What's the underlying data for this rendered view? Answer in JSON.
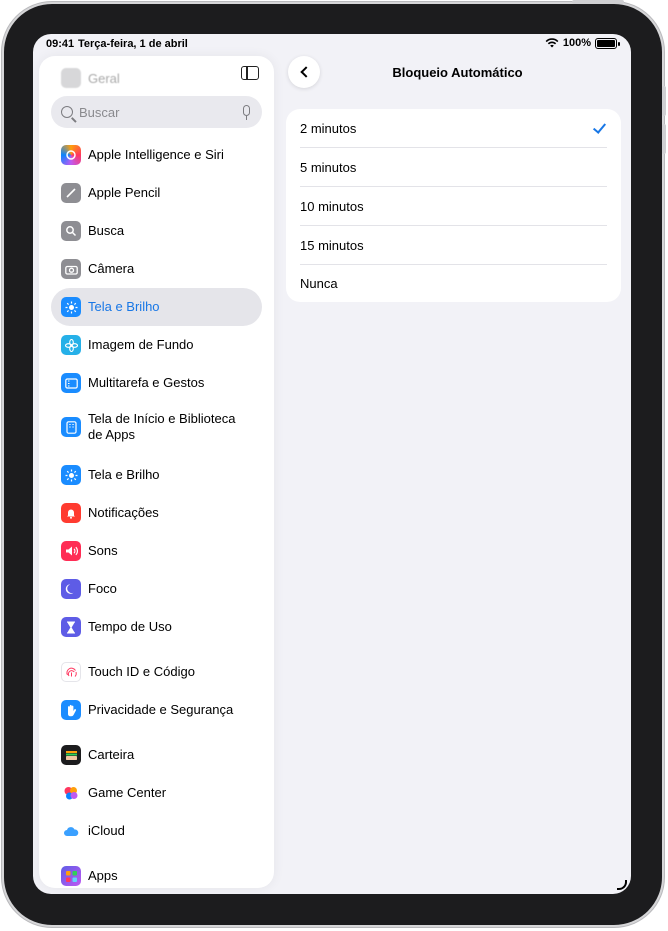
{
  "statusbar": {
    "time": "09:41",
    "date": "Terça-feira, 1 de abril",
    "battery": "100%"
  },
  "sidebar": {
    "hidden_top_item": "Geral",
    "search_placeholder": "Buscar",
    "items": [
      {
        "label": "Apple Intelligence e Siri",
        "icon": "apple-intelligence-icon",
        "color": "#ff7a59"
      },
      {
        "label": "Apple Pencil",
        "icon": "pencil-icon",
        "color": "#8e8e93"
      },
      {
        "label": "Busca",
        "icon": "search-icon",
        "color": "#8e8e93"
      },
      {
        "label": "Câmera",
        "icon": "camera-icon",
        "color": "#8e8e93"
      },
      {
        "label": "Tela e Brilho",
        "icon": "sun-icon",
        "color": "#1a8cff",
        "selected": true
      },
      {
        "label": "Imagem de Fundo",
        "icon": "flower-icon",
        "color": "#26b0e8"
      },
      {
        "label": "Multitarefa e Gestos",
        "icon": "multitask-icon",
        "color": "#1a8cff"
      },
      {
        "label": "Tela de Início e Biblioteca de Apps",
        "icon": "home-screen-icon",
        "color": "#1a8cff"
      },
      {
        "label": "Tela e Brilho",
        "icon": "sun-icon",
        "color": "#1a8cff"
      },
      {
        "label": "Notificações",
        "icon": "bell-icon",
        "color": "#ff3b30"
      },
      {
        "label": "Sons",
        "icon": "speaker-icon",
        "color": "#ff2d55"
      },
      {
        "label": "Foco",
        "icon": "moon-icon",
        "color": "#5e5ce6"
      },
      {
        "label": "Tempo de Uso",
        "icon": "hourglass-icon",
        "color": "#5e5ce6"
      },
      {
        "label": "Touch ID e Código",
        "icon": "fingerprint-icon",
        "color": "#ffffff"
      },
      {
        "label": "Privacidade e Segurança",
        "icon": "hand-icon",
        "color": "#1a8cff"
      },
      {
        "label": "Carteira",
        "icon": "wallet-icon",
        "color": "#1c1c1e"
      },
      {
        "label": "Game Center",
        "icon": "game-center-icon",
        "color": "#ffffff"
      },
      {
        "label": "iCloud",
        "icon": "cloud-icon",
        "color": "#ffffff"
      },
      {
        "label": "Apps",
        "icon": "apps-grid-icon",
        "color": "#7b45e0"
      }
    ]
  },
  "detail": {
    "title": "Bloqueio Automático",
    "options": [
      "2 minutos",
      "5 minutos",
      "10 minutos",
      "15 minutos",
      "Nunca"
    ],
    "selected_option": "2 minutos"
  },
  "colors": {
    "accent": "#1877e6",
    "background": "#f2f2f7",
    "selected_row": "#e5e5ea"
  }
}
